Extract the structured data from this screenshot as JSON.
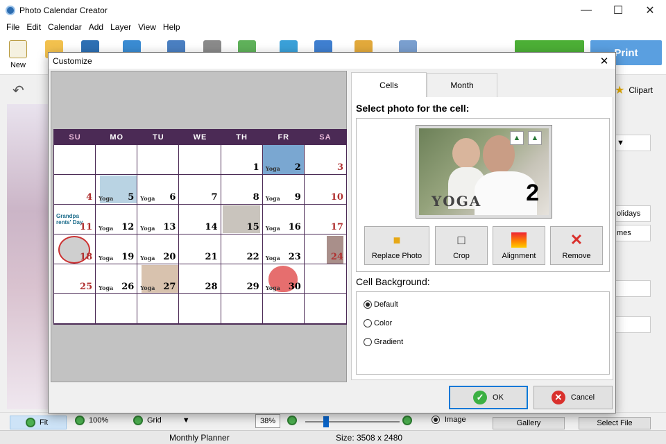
{
  "app": {
    "title": "Photo Calendar Creator"
  },
  "menu": [
    "File",
    "Edit",
    "Calendar",
    "Add",
    "Layer",
    "View",
    "Help"
  ],
  "toolbar": {
    "new_label": "New",
    "print_label": "Print",
    "clipart_label": "Clipart"
  },
  "right_panel": {
    "holidays_label": "olidays",
    "names_label": "mes"
  },
  "bottom_bar": {
    "fit_label": "Fit",
    "zoom100_label": "100%",
    "grid_label": "Grid",
    "zoom_value": "38%",
    "image_label": "Image",
    "gallery_label": "Gallery",
    "select_file_label": "Select File"
  },
  "status": {
    "template": "Monthly Planner",
    "size": "Size: 3508 x 2480"
  },
  "dialog": {
    "title": "Customize",
    "tabs": [
      {
        "label": "Cells"
      },
      {
        "label": "Month"
      }
    ],
    "select_photo_label": "Select photo for the cell:",
    "preview_photo": {
      "note": "YOGA",
      "number": "2"
    },
    "actions": [
      {
        "label": "Replace Photo"
      },
      {
        "label": "Crop"
      },
      {
        "label": "Alignment"
      },
      {
        "label": "Remove"
      }
    ],
    "cell_background_label": "Cell Background:",
    "background_options": [
      {
        "label": "Default",
        "selected": true
      },
      {
        "label": "Color",
        "selected": false
      },
      {
        "label": "Gradient",
        "selected": false
      }
    ],
    "ok_label": "OK",
    "cancel_label": "Cancel"
  },
  "calendar": {
    "weekdays": [
      "SU",
      "MO",
      "TU",
      "WE",
      "TH",
      "FR",
      "SA"
    ],
    "weeks": [
      [
        "",
        "",
        "",
        "",
        "1",
        "2",
        "3"
      ],
      [
        "4",
        "5",
        "6",
        "7",
        "8",
        "9",
        "10"
      ],
      [
        "11",
        "12",
        "13",
        "14",
        "15",
        "16",
        "17"
      ],
      [
        "18",
        "19",
        "20",
        "21",
        "22",
        "23",
        "24"
      ],
      [
        "25",
        "26",
        "27",
        "28",
        "29",
        "30",
        ""
      ],
      [
        "",
        "",
        "",
        "",
        "",
        "",
        ""
      ]
    ],
    "notes": {
      "2": "Yoga",
      "5": "Yoga",
      "6": "Yoga",
      "9": "Yoga",
      "12": "Yoga",
      "13": "Yoga",
      "16": "Yoga",
      "19": "Yoga",
      "20": "Yoga",
      "23": "Yoga",
      "26": "Yoga",
      "27": "Yoga",
      "30": "Yoga"
    },
    "holiday": {
      "day": "11",
      "text": "Grandpa rents' Day"
    },
    "selected_day": "2"
  }
}
